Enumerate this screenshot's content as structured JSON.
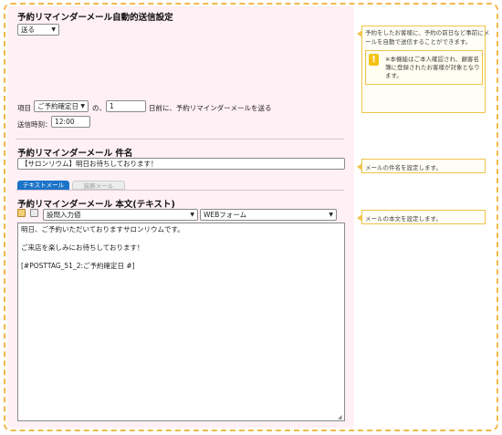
{
  "section1": {
    "title": "予約リマインダーメール自動的送信設定",
    "send_select": "送る",
    "note": {
      "text_line1": "予約をしたお客様に、予約の前日など事前にメ",
      "text_line2": "ールを自動で送信することができます。",
      "warn_line1": "※本機能はご本人確認され、顧客名",
      "warn_line2": "簿に登録されたお客様が対象となり",
      "warn_line3": "ます。"
    },
    "row1": {
      "prefix": "項目",
      "item_select": "ご予約確定日",
      "middle": "の、",
      "days_value": "1",
      "suffix": "日前に、予約リマインダーメールを送る"
    },
    "row2": {
      "label": "送信時刻：",
      "time_value": "12:00"
    }
  },
  "section2": {
    "title": "予約リマインダーメール 件名",
    "subject_value": "【サロンリウム】明日お待ちしております！",
    "note": "メールの件名を設定します。"
  },
  "tabs": {
    "text_mail": "テキストメール",
    "html_mail": "装飾メール"
  },
  "section3": {
    "title": "予約リマインダーメール 本文(テキスト)",
    "insert_select": "設問入力値",
    "form_select": "WEBフォーム",
    "note": "メールの本文を設定します。",
    "body_lines": [
      "明日、ご予約いただいておりますサロンリウムです。",
      "",
      "ご来店を楽しみにお待ちしております！",
      "",
      "[#POSTTAG_51_2:ご予約確定日 #]"
    ]
  }
}
